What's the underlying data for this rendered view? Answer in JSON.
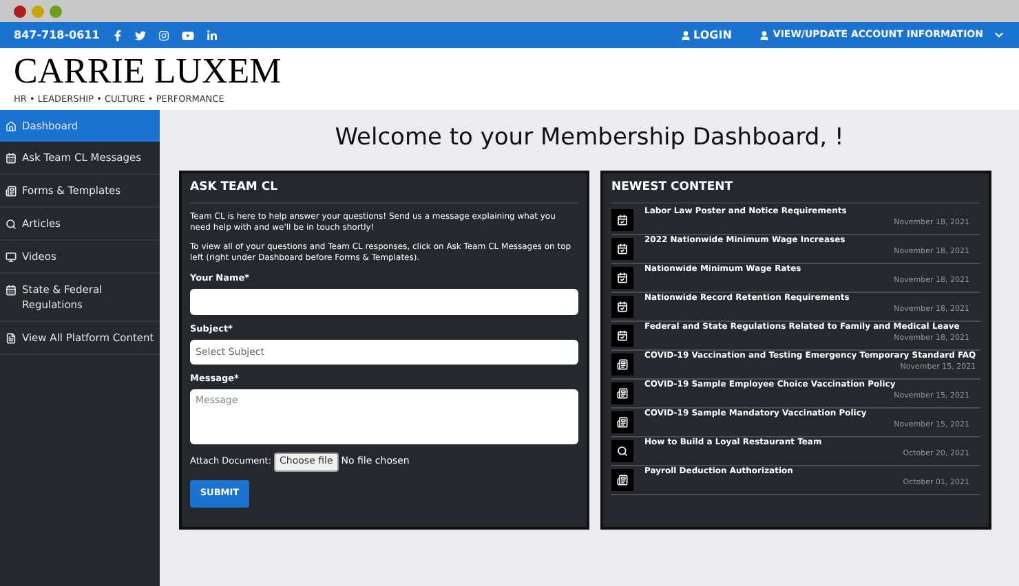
{
  "topbar": {
    "phone": "847-718-0611",
    "login": "LOGIN",
    "account": "VIEW/UPDATE ACCOUNT INFORMATION"
  },
  "logo": {
    "name": "CARRIE LUXEM",
    "tagline": "HR • LEADERSHIP • CULTURE • PERFORMANCE"
  },
  "sidebar": {
    "items": [
      {
        "label": "Dashboard",
        "kind": "home",
        "selected": true
      },
      {
        "label": "Ask Team CL Messages",
        "kind": "calendar",
        "selected": false
      },
      {
        "label": "Forms & Templates",
        "kind": "form",
        "selected": false
      },
      {
        "label": "Articles",
        "kind": "search",
        "selected": false
      },
      {
        "label": "Videos",
        "kind": "monitor",
        "selected": false
      },
      {
        "label": "State & Federal Regulations",
        "kind": "calendar",
        "selected": false
      },
      {
        "label": "View All Platform Content",
        "kind": "file",
        "selected": false
      }
    ]
  },
  "heading": "Welcome to your Membership Dashboard, !",
  "ask_panel": {
    "title": "ASK TEAM CL",
    "intro": "Team CL is here to help answer your questions! Send us a message explaining what you need help with and we'll be in touch shortly!",
    "note": "To view all of your questions and Team CL responses, click on Ask Team CL Messages on top left (right under Dashboard before Forms & Templates).",
    "name_label": "Your Name*",
    "subject_label": "Subject*",
    "subject_placeholder": "Select Subject",
    "message_label": "Message*",
    "message_placeholder": "Message",
    "attach_label": "Attach Document:",
    "file_button": "Choose file",
    "file_status": "No file chosen",
    "submit": "SUBMIT"
  },
  "newest": {
    "title": "NEWEST CONTENT",
    "items": [
      {
        "kind": "calendar",
        "title": "Labor Law Poster and Notice Requirements",
        "date": "November 18, 2021"
      },
      {
        "kind": "calendar",
        "title": "2022 Nationwide Minimum Wage Increases",
        "date": "November 18, 2021"
      },
      {
        "kind": "calendar",
        "title": "Nationwide Minimum Wage Rates",
        "date": "November 18, 2021"
      },
      {
        "kind": "calendar",
        "title": "Nationwide Record Retention Requirements",
        "date": "November 18, 2021"
      },
      {
        "kind": "calendar",
        "title": "Federal and State Regulations Related to Family and Medical Leave",
        "date": "November 18, 2021"
      },
      {
        "kind": "form",
        "title": "COVID-19 Vaccination and Testing Emergency Temporary Standard FAQ",
        "date": "November 15, 2021"
      },
      {
        "kind": "form",
        "title": "COVID-19 Sample Employee Choice Vaccination Policy",
        "date": "November 15, 2021"
      },
      {
        "kind": "form",
        "title": "COVID-19 Sample Mandatory Vaccination Policy",
        "date": "November 15, 2021"
      },
      {
        "kind": "search",
        "title": "How to Build a Loyal Restaurant Team",
        "date": "October 20, 2021"
      },
      {
        "kind": "form",
        "title": "Payroll Deduction Authorization",
        "date": "October 01, 2021"
      }
    ]
  }
}
